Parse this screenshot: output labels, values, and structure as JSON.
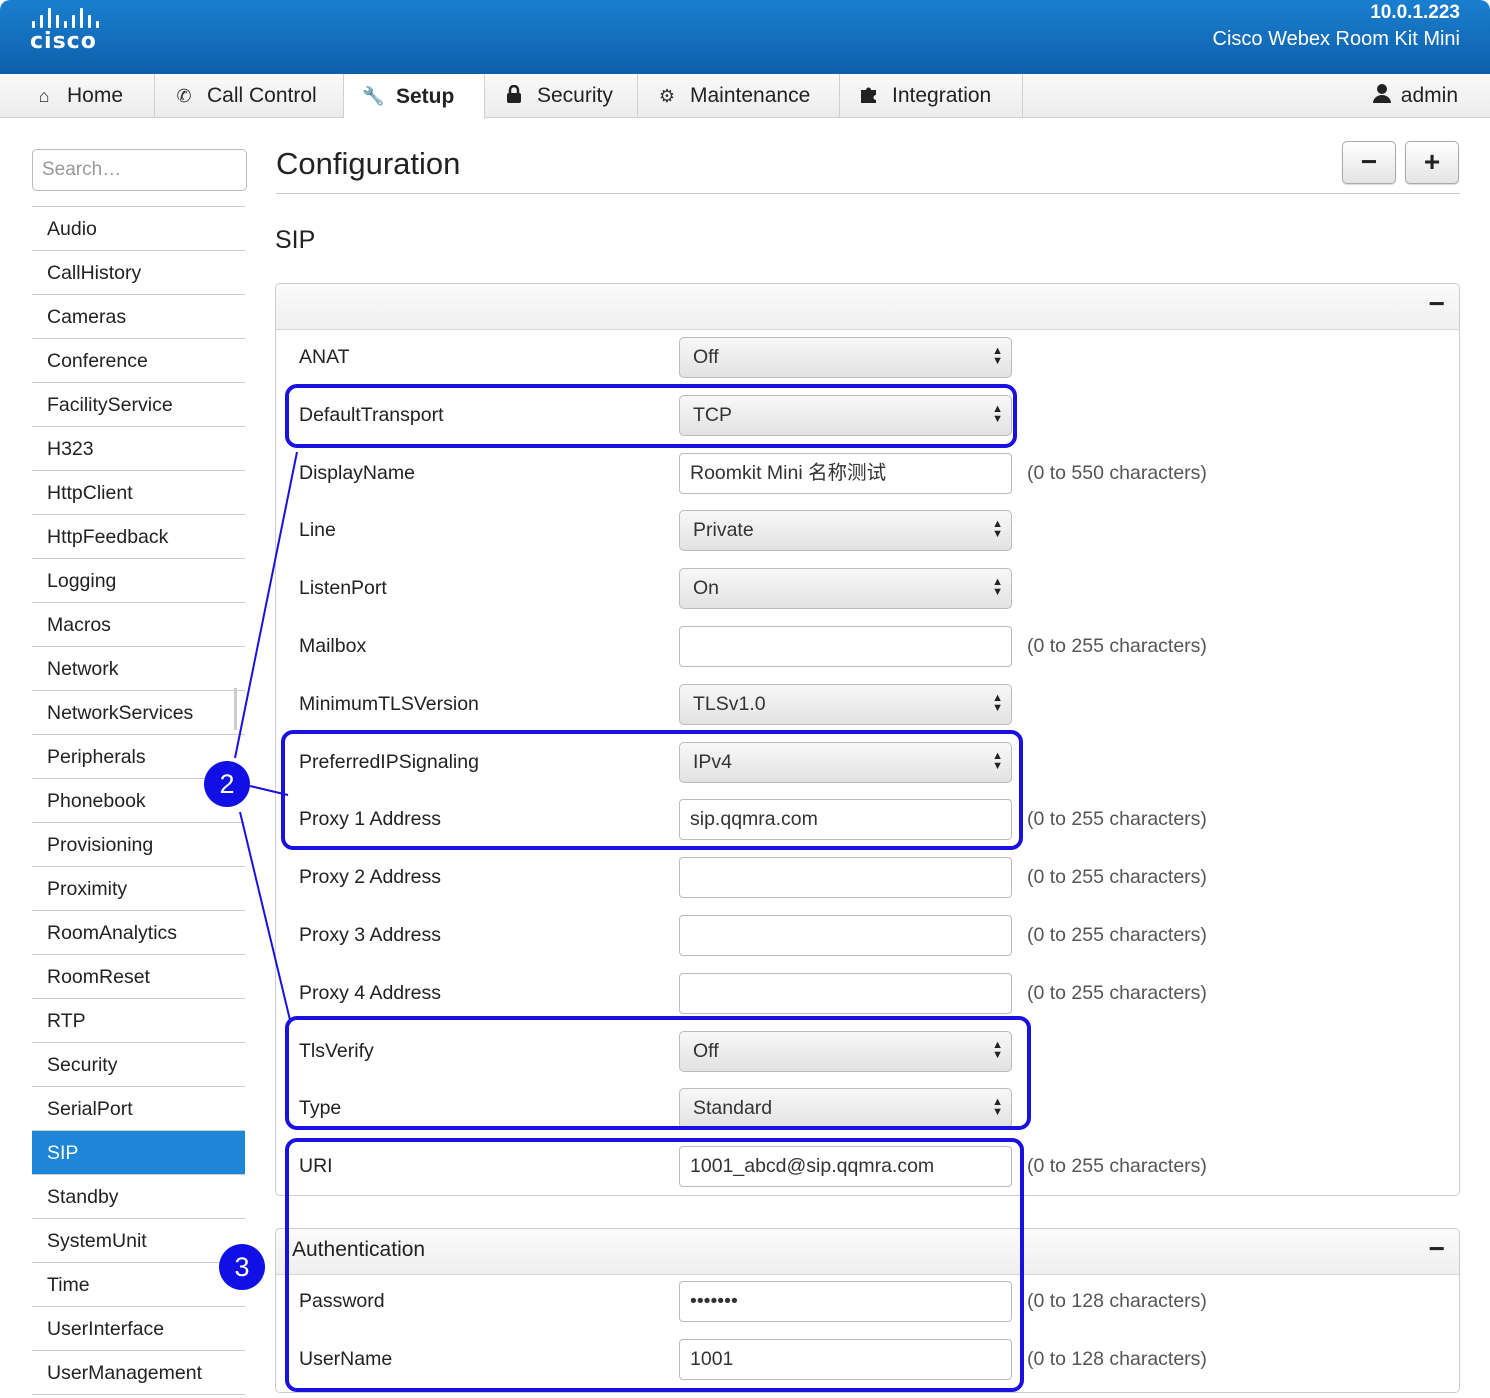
{
  "header": {
    "logo_text": "cisco",
    "ip_address": "10.0.1.223",
    "device_name": "Cisco Webex Room Kit Mini",
    "brand_color": "#1a7fd0"
  },
  "nav": {
    "tabs": [
      {
        "label": "Home",
        "icon": "home-icon"
      },
      {
        "label": "Call Control",
        "icon": "phone-icon"
      },
      {
        "label": "Setup",
        "icon": "wrench-icon"
      },
      {
        "label": "Security",
        "icon": "lock-icon"
      },
      {
        "label": "Maintenance",
        "icon": "gear-icon"
      },
      {
        "label": "Integration",
        "icon": "puzzle-icon"
      }
    ],
    "active_tab": "Setup",
    "user": {
      "label": "admin",
      "icon": "user-icon"
    }
  },
  "sidebar": {
    "search_placeholder": "Search…",
    "items": [
      "Audio",
      "CallHistory",
      "Cameras",
      "Conference",
      "FacilityService",
      "H323",
      "HttpClient",
      "HttpFeedback",
      "Logging",
      "Macros",
      "Network",
      "NetworkServices",
      "Peripherals",
      "Phonebook",
      "Provisioning",
      "Proximity",
      "RoomAnalytics",
      "RoomReset",
      "RTP",
      "Security",
      "SerialPort",
      "SIP",
      "Standby",
      "SystemUnit",
      "Time",
      "UserInterface",
      "UserManagement"
    ],
    "active_item": "SIP",
    "active_color": "#1d86d6"
  },
  "main": {
    "page_title": "Configuration",
    "collapse_all_label": "−",
    "expand_all_label": "+",
    "section_title": "SIP",
    "panel_collapse_label": "−",
    "sip_rows": [
      {
        "label": "ANAT",
        "type": "select",
        "value": "Off",
        "hint": ""
      },
      {
        "label": "DefaultTransport",
        "type": "select",
        "value": "TCP",
        "hint": ""
      },
      {
        "label": "DisplayName",
        "type": "input",
        "value": "Roomkit Mini 名称测试",
        "hint": "(0 to 550 characters)"
      },
      {
        "label": "Line",
        "type": "select",
        "value": "Private",
        "hint": ""
      },
      {
        "label": "ListenPort",
        "type": "select",
        "value": "On",
        "hint": ""
      },
      {
        "label": "Mailbox",
        "type": "input",
        "value": "",
        "hint": "(0 to 255 characters)"
      },
      {
        "label": "MinimumTLSVersion",
        "type": "select",
        "value": "TLSv1.0",
        "hint": ""
      },
      {
        "label": "PreferredIPSignaling",
        "type": "select",
        "value": "IPv4",
        "hint": ""
      },
      {
        "label": "Proxy 1 Address",
        "type": "input",
        "value": "sip.qqmra.com",
        "hint": "(0 to 255 characters)"
      },
      {
        "label": "Proxy 2 Address",
        "type": "input",
        "value": "",
        "hint": "(0 to 255 characters)"
      },
      {
        "label": "Proxy 3 Address",
        "type": "input",
        "value": "",
        "hint": "(0 to 255 characters)"
      },
      {
        "label": "Proxy 4 Address",
        "type": "input",
        "value": "",
        "hint": "(0 to 255 characters)"
      },
      {
        "label": "TlsVerify",
        "type": "select",
        "value": "Off",
        "hint": ""
      },
      {
        "label": "Type",
        "type": "select",
        "value": "Standard",
        "hint": ""
      },
      {
        "label": "URI",
        "type": "input",
        "value": "1001_abcd@sip.qqmra.com",
        "hint": "(0 to 255 characters)"
      }
    ],
    "auth": {
      "title": "Authentication",
      "collapse_label": "−",
      "rows": [
        {
          "label": "Password",
          "type": "input",
          "value": "•••••••",
          "hint": "(0 to 128 characters)"
        },
        {
          "label": "UserName",
          "type": "input",
          "value": "1001",
          "hint": "(0 to 128 characters)"
        }
      ]
    }
  },
  "annotations": {
    "badges": [
      "2",
      "3"
    ],
    "color": "#1a10e0"
  }
}
